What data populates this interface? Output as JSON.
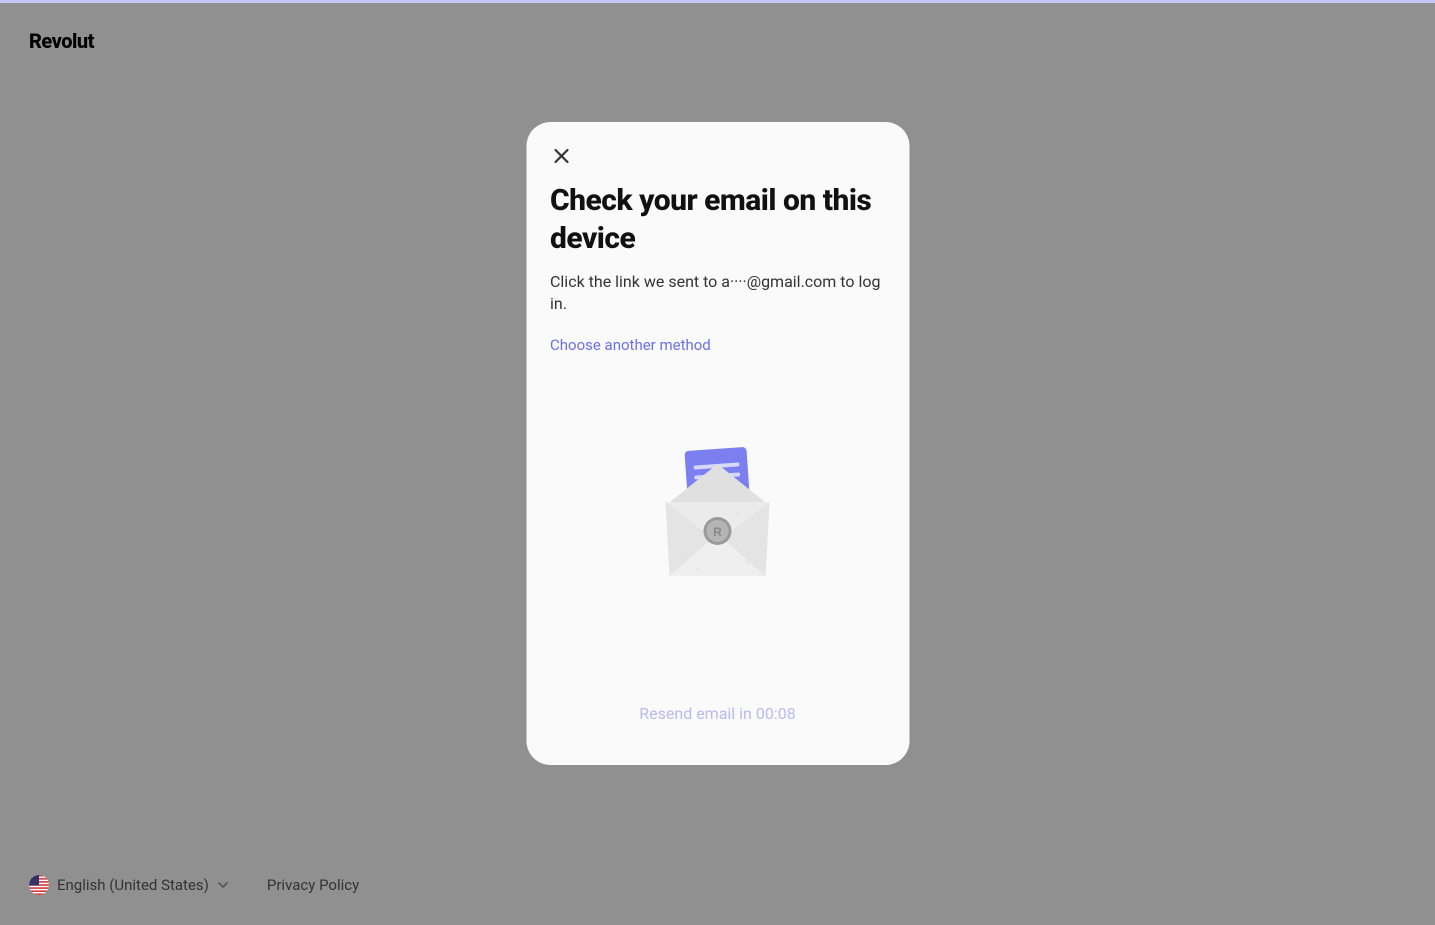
{
  "header": {
    "logo_text": "Revolut"
  },
  "modal": {
    "title": "Check your email on this device",
    "description": "Click the link we sent to a····@gmail.com to log in.",
    "alt_method_label": "Choose another method",
    "resend_label": "Resend email in 00:08",
    "illustration_name": "email-envelope-icon"
  },
  "footer": {
    "language_label": "English (United States)",
    "privacy_label": "Privacy Policy"
  }
}
